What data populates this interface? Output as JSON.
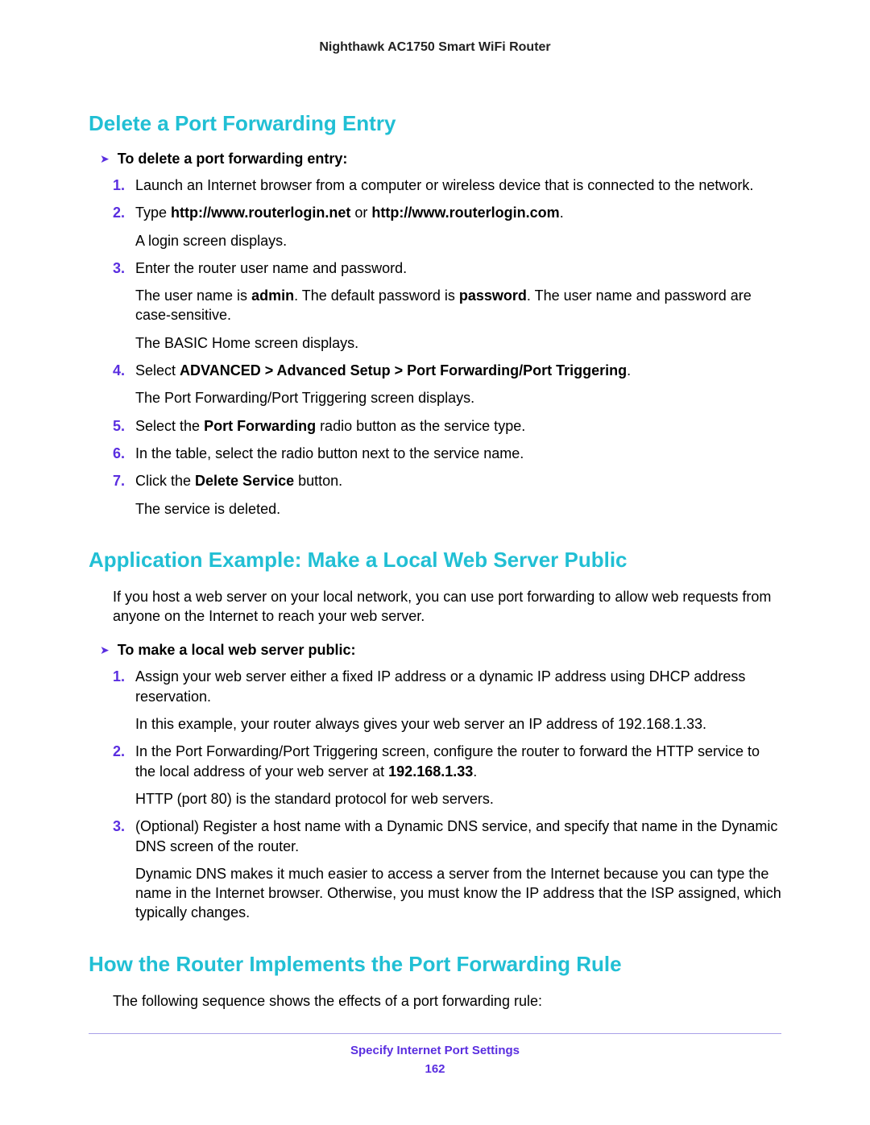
{
  "doc_title": "Nighthawk AC1750 Smart WiFi Router",
  "footer": {
    "title": "Specify Internet Port Settings",
    "page": "162"
  },
  "section1": {
    "heading": "Delete a Port Forwarding Entry",
    "task_label": "To delete a port forwarding entry:",
    "steps": {
      "s1": "Launch an Internet browser from a computer or wireless device that is connected to the network.",
      "s2_pre": "Type ",
      "s2_b1": "http://www.routerlogin.net",
      "s2_mid": " or ",
      "s2_b2": "http://www.routerlogin.com",
      "s2_post": ".",
      "s2_p": "A login screen displays.",
      "s3": "Enter the router user name and password.",
      "s3_p1a": "The user name is ",
      "s3_p1b": "admin",
      "s3_p1c": ". The default password is ",
      "s3_p1d": "password",
      "s3_p1e": ". The user name and password are case-sensitive.",
      "s3_p2": "The BASIC Home screen displays.",
      "s4_pre": "Select ",
      "s4_b": "ADVANCED > Advanced Setup > Port Forwarding/Port Triggering",
      "s4_post": ".",
      "s4_p": "The Port Forwarding/Port Triggering screen displays.",
      "s5_pre": "Select the ",
      "s5_b": "Port Forwarding",
      "s5_post": " radio button as the service type.",
      "s6": "In the table, select the radio button next to the service name.",
      "s7_pre": "Click the ",
      "s7_b": "Delete Service",
      "s7_post": " button.",
      "s7_p": "The service is deleted."
    }
  },
  "section2": {
    "heading": "Application Example: Make a Local Web Server Public",
    "intro": "If you host a web server on your local network, you can use port forwarding to allow web requests from anyone on the Internet to reach your web server.",
    "task_label": "To make a local web server public:",
    "steps": {
      "s1": "Assign your web server either a fixed IP address or a dynamic IP address using DHCP address reservation.",
      "s1_p": "In this example, your router always gives your web server an IP address of 192.168.1.33.",
      "s2_pre": "In the Port Forwarding/Port Triggering screen, configure the router to forward the HTTP service to the local address of your web server at ",
      "s2_b": "192.168.1.33",
      "s2_post": ".",
      "s2_p": "HTTP (port 80) is the standard protocol for web servers.",
      "s3": "(Optional) Register a host name with a Dynamic DNS service, and specify that name in the Dynamic DNS screen of the router.",
      "s3_p": "Dynamic DNS makes it much easier to access a server from the Internet because you can type the name in the Internet browser. Otherwise, you must know the IP address that the ISP assigned, which typically changes."
    }
  },
  "section3": {
    "heading": "How the Router Implements the Port Forwarding Rule",
    "intro": "The following sequence shows the effects of a port forwarding rule:"
  }
}
